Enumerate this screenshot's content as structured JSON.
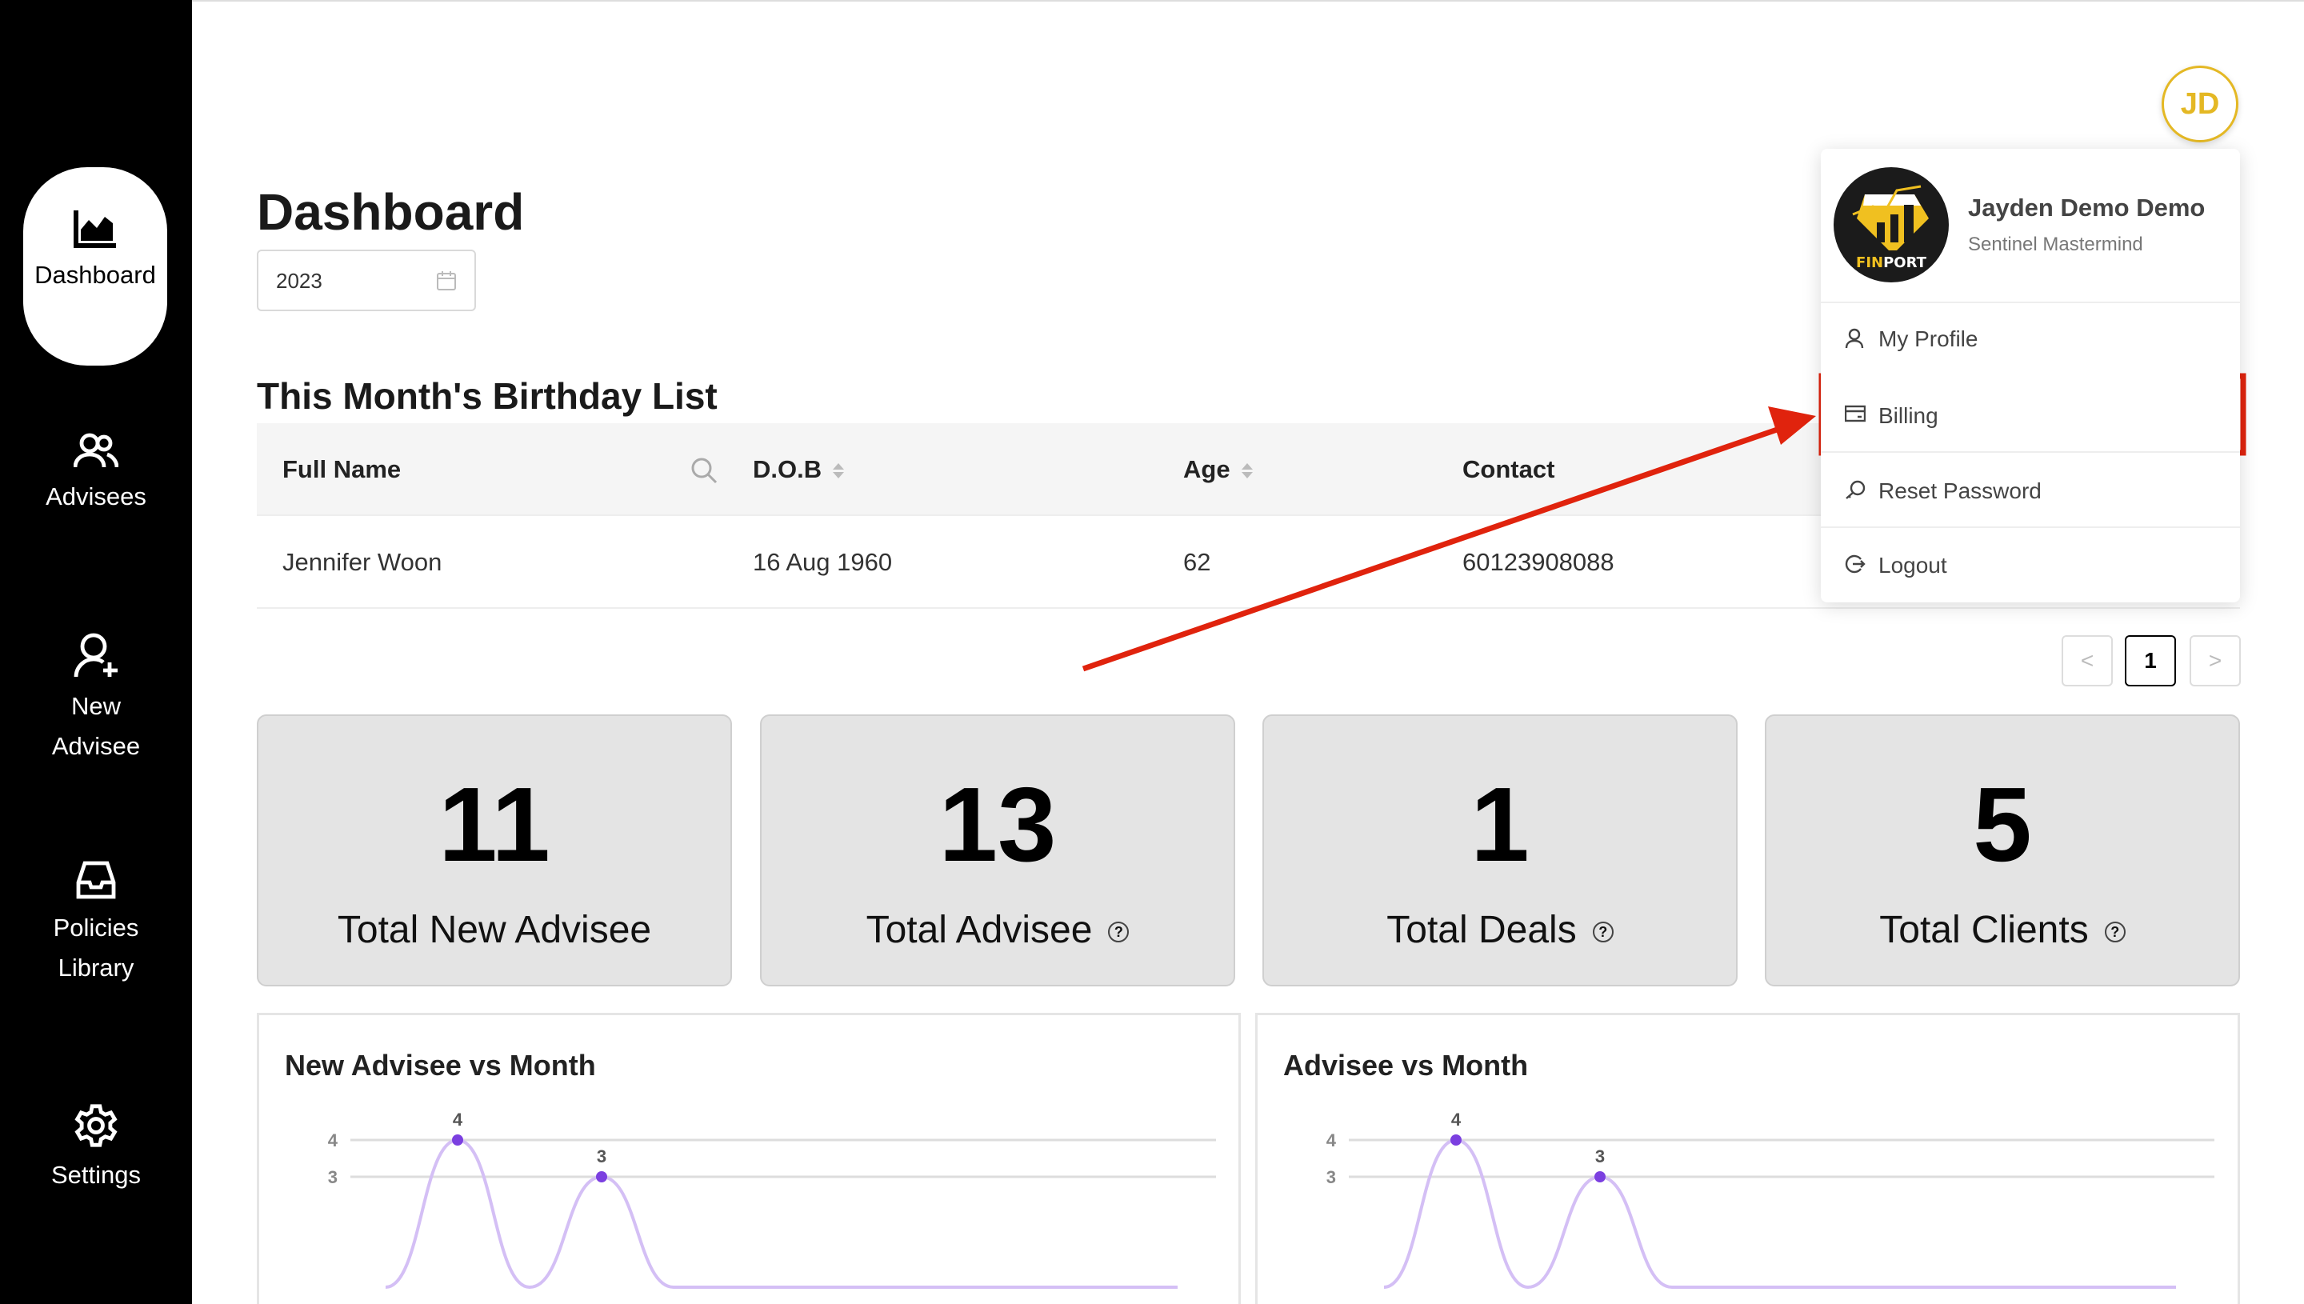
{
  "sidebar": {
    "items": [
      {
        "label": "Dashboard",
        "icon": "area-chart-icon",
        "active": true
      },
      {
        "label": "Advisees",
        "icon": "users-icon"
      },
      {
        "label": "New Advisee",
        "icon": "user-add-icon"
      },
      {
        "label": "Policies Library",
        "icon": "inbox-icon"
      },
      {
        "label": "Settings",
        "icon": "gear-icon"
      }
    ]
  },
  "header": {
    "title": "Dashboard",
    "year": "2023",
    "avatar_initials": "JD"
  },
  "birthday": {
    "title": "This Month's Birthday List",
    "columns": [
      "Full Name",
      "D.O.B",
      "Age",
      "Contact"
    ],
    "rows": [
      {
        "name": "Jennifer Woon",
        "dob": "16 Aug 1960",
        "age": "62",
        "contact": "60123908088"
      }
    ]
  },
  "pagination": {
    "current": "1",
    "prev": "<",
    "next": ">"
  },
  "stats": [
    {
      "value": "11",
      "label": "Total New Advisee"
    },
    {
      "value": "13",
      "label": "Total Advisee"
    },
    {
      "value": "1",
      "label": "Total Deals"
    },
    {
      "value": "5",
      "label": "Total Clients"
    }
  ],
  "profile_menu": {
    "name": "Jayden Demo Demo",
    "role": "Sentinel Mastermind",
    "logo_text": "FINPORT",
    "items": [
      "My Profile",
      "Billing",
      "Reset Password",
      "Logout"
    ],
    "highlighted": "Billing"
  },
  "colors": {
    "accent": "#e4b824",
    "highlight": "#e0230d",
    "line": "#d4bff5",
    "point": "#7b3fe0"
  },
  "chart_data": [
    {
      "type": "line",
      "title": "New Advisee vs Month",
      "ytick_labels": [
        "3",
        "4"
      ],
      "values": [
        0,
        4,
        0,
        3,
        0,
        0,
        0,
        0,
        0,
        0,
        0,
        0
      ],
      "data_labels": [
        "4",
        "3"
      ],
      "grid": true
    },
    {
      "type": "line",
      "title": "Advisee vs Month",
      "ytick_labels": [
        "3",
        "4"
      ],
      "values": [
        0,
        4,
        0,
        3,
        0,
        0,
        0,
        0,
        0,
        0,
        0,
        0
      ],
      "data_labels": [
        "4",
        "3"
      ],
      "grid": true
    }
  ]
}
